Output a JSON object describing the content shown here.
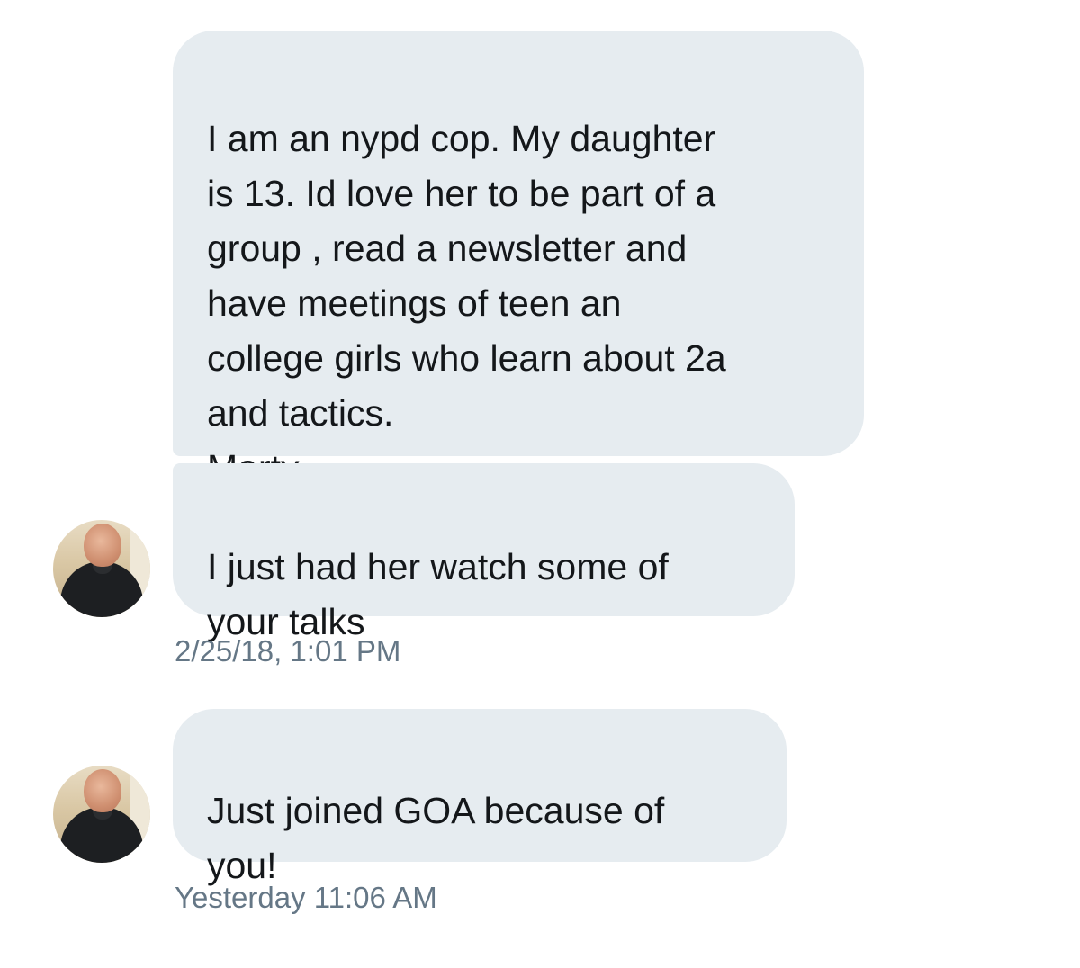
{
  "conversation": {
    "messages": [
      {
        "text": "I am an nypd cop. My daughter\nis 13. Id love her to be part of a\ngroup , read a newsletter and\nhave meetings of teen an\ncollege girls who learn about 2a\nand tactics.\nMarty"
      },
      {
        "text": "I just had her watch some of\nyour talks"
      },
      {
        "text": "Just joined GOA because of\nyou!"
      }
    ],
    "timestamps": [
      "2/25/18, 1:01 PM",
      "Yesterday 11:06 AM"
    ]
  },
  "colors": {
    "bubble_background": "#e6ecf0",
    "message_text": "#14171a",
    "timestamp_text": "#657786"
  }
}
